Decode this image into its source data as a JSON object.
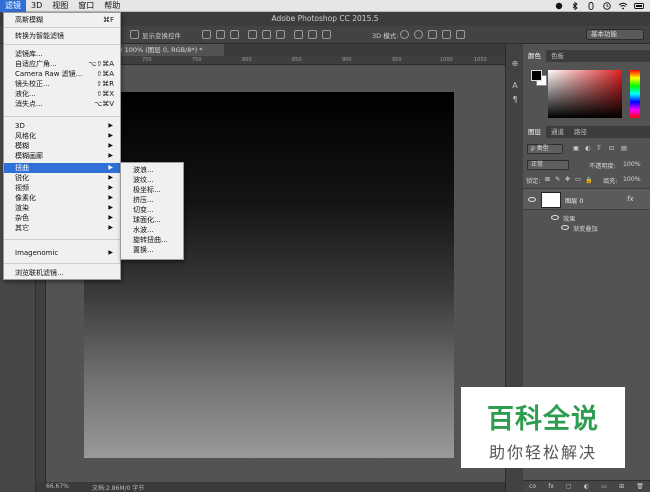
{
  "menubar": {
    "items": [
      "滤镜",
      "3D",
      "视图",
      "窗口",
      "帮助"
    ],
    "active_index": 0
  },
  "app_title": "Adobe Photoshop CC 2015.5",
  "options_bar": {
    "show_transform": "显示变换控件",
    "mode_3d": "3D 模式:",
    "workspace": "基本功能"
  },
  "document": {
    "tab_title": "@ 100% (图层 0, RGB/8*) *",
    "zoom": "66.67%",
    "doc_info": "文档:2.86M/0 字节",
    "ruler_marks": [
      "700",
      "750",
      "800",
      "850",
      "900",
      "950",
      "1000",
      "1050"
    ]
  },
  "filter_menu": {
    "items": [
      {
        "label": "高斯模糊",
        "shortcut": "⌘F"
      },
      {
        "label": "转换为智能滤镜"
      },
      {
        "label": "滤镜库..."
      },
      {
        "label": "自适应广角...",
        "shortcut": "⌥⇧⌘A"
      },
      {
        "label": "Camera Raw 滤镜...",
        "shortcut": "⇧⌘A"
      },
      {
        "label": "镜头校正...",
        "shortcut": "⇧⌘R"
      },
      {
        "label": "液化...",
        "shortcut": "⇧⌘X"
      },
      {
        "label": "消失点...",
        "shortcut": "⌥⌘V"
      },
      {
        "label": "3D"
      },
      {
        "label": "风格化"
      },
      {
        "label": "模糊"
      },
      {
        "label": "模糊画廊"
      },
      {
        "label": "扭曲"
      },
      {
        "label": "锐化"
      },
      {
        "label": "视频"
      },
      {
        "label": "像素化"
      },
      {
        "label": "渲染"
      },
      {
        "label": "杂色"
      },
      {
        "label": "其它"
      },
      {
        "label": "Imagenomic"
      },
      {
        "label": "浏览联机滤镜..."
      }
    ]
  },
  "distort_submenu": {
    "items": [
      "波浪...",
      "波纹...",
      "极坐标...",
      "挤压...",
      "切变...",
      "球面化...",
      "水波...",
      "旋转扭曲...",
      "置换..."
    ]
  },
  "color_panel": {
    "tabs": [
      "颜色",
      "色板"
    ]
  },
  "layers_panel": {
    "tabs": [
      "图层",
      "通道",
      "路径"
    ],
    "kind_filter": "ρ 类型",
    "blend_mode": "正常",
    "opacity_label": "不透明度:",
    "opacity_value": "100%",
    "lock_label": "锁定:",
    "fill_label": "填充:",
    "fill_value": "100%",
    "layer_name": "图层 0",
    "fx_label": "fx",
    "effects_label": "效果",
    "effect_item": "渐变叠加",
    "bottom_icons": [
      "co",
      "fx",
      "▢",
      "◐",
      "▭",
      "⊞",
      "🗑"
    ]
  },
  "watermark": {
    "title": "百科全说",
    "subtitle": "助你轻松解决"
  }
}
